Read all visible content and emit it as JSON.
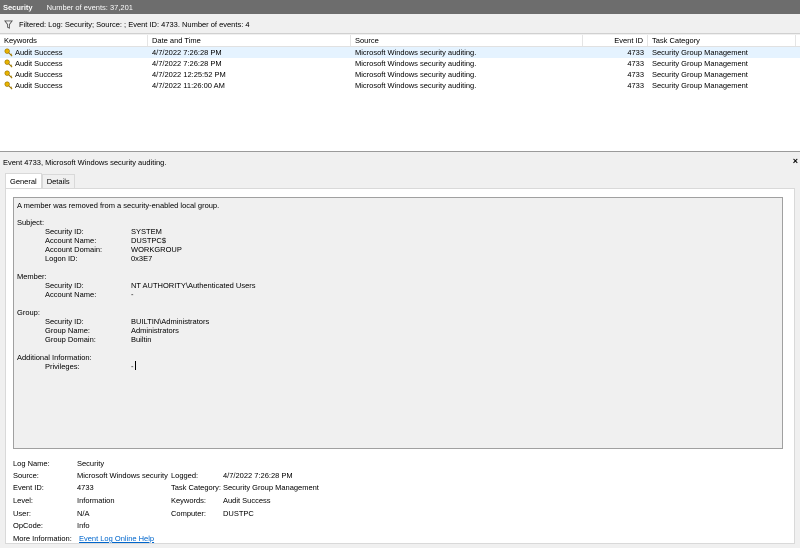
{
  "header": {
    "title": "Security",
    "count": "Number of events: 37,201"
  },
  "filter": {
    "text": "Filtered: Log: Security; Source: ; Event ID: 4733. Number of events: 4"
  },
  "grid": {
    "columns": [
      "Keywords",
      "Date and Time",
      "Source",
      "Event ID",
      "Task Category"
    ],
    "rows": [
      {
        "keywords": "Audit Success",
        "date": "4/7/2022 7:26:28 PM",
        "source": "Microsoft Windows security auditing.",
        "event_id": "4733",
        "task": "Security Group Management"
      },
      {
        "keywords": "Audit Success",
        "date": "4/7/2022 7:26:28 PM",
        "source": "Microsoft Windows security auditing.",
        "event_id": "4733",
        "task": "Security Group Management"
      },
      {
        "keywords": "Audit Success",
        "date": "4/7/2022 12:25:52 PM",
        "source": "Microsoft Windows security auditing.",
        "event_id": "4733",
        "task": "Security Group Management"
      },
      {
        "keywords": "Audit Success",
        "date": "4/7/2022 11:26:00 AM",
        "source": "Microsoft Windows security auditing.",
        "event_id": "4733",
        "task": "Security Group Management"
      }
    ]
  },
  "detail": {
    "header": "Event 4733, Microsoft Windows security auditing.",
    "close": "×",
    "tabs": {
      "general": "General",
      "details": "Details"
    },
    "message": {
      "line0": "A member was removed from a security-enabled local group.",
      "subject_h": "Subject:",
      "subj_sid_l": "Security ID:",
      "subj_sid_v": "SYSTEM",
      "subj_acc_l": "Account Name:",
      "subj_acc_v": "DUSTPC$",
      "subj_dom_l": "Account Domain:",
      "subj_dom_v": "WORKGROUP",
      "subj_logon_l": "Logon ID:",
      "subj_logon_v": "0x3E7",
      "member_h": "Member:",
      "mem_sid_l": "Security ID:",
      "mem_sid_v": "NT AUTHORITY\\Authenticated Users",
      "mem_acc_l": "Account Name:",
      "mem_acc_v": "-",
      "group_h": "Group:",
      "grp_sid_l": "Security ID:",
      "grp_sid_v": "BUILTIN\\Administrators",
      "grp_name_l": "Group Name:",
      "grp_name_v": "Administrators",
      "grp_dom_l": "Group Domain:",
      "grp_dom_v": "Builtin",
      "add_h": "Additional Information:",
      "priv_l": "Privileges:",
      "priv_v": "-"
    },
    "info": {
      "log_name_l": "Log Name:",
      "log_name_v": "Security",
      "source_l": "Source:",
      "source_v": "Microsoft Windows security",
      "logged_l": "Logged:",
      "logged_v": "4/7/2022 7:26:28 PM",
      "event_id_l": "Event ID:",
      "event_id_v": "4733",
      "task_l": "Task Category:",
      "task_v": "Security Group Management",
      "level_l": "Level:",
      "level_v": "Information",
      "keywords_l": "Keywords:",
      "keywords_v": "Audit Success",
      "user_l": "User:",
      "user_v": "N/A",
      "computer_l": "Computer:",
      "computer_v": "DUSTPC",
      "opcode_l": "OpCode:",
      "opcode_v": "Info",
      "more_l": "More Information:",
      "more_v": "Event Log Online Help"
    }
  }
}
